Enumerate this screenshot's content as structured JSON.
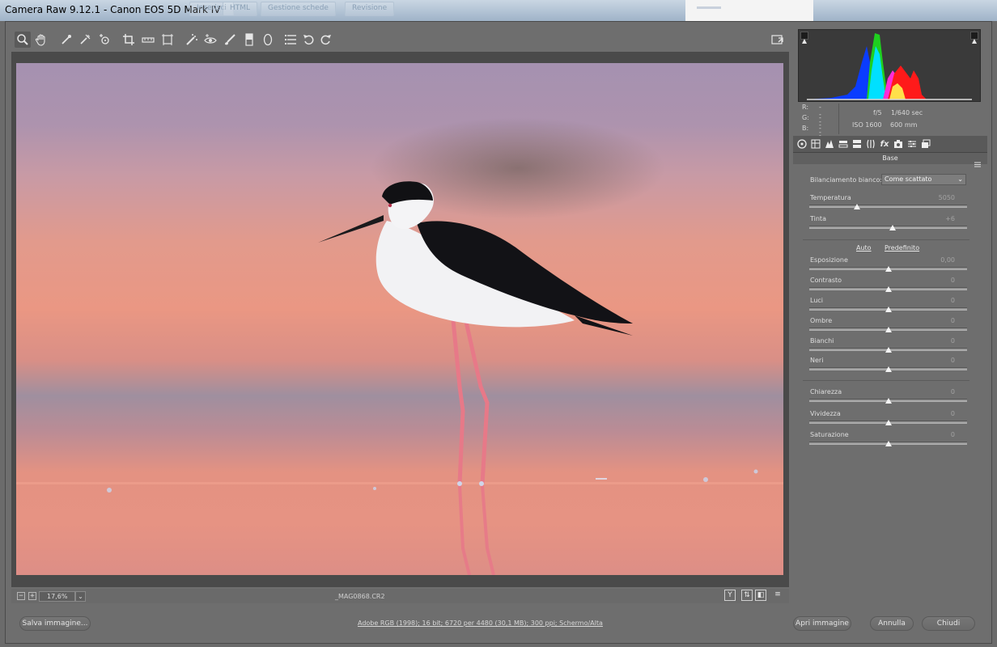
{
  "window": {
    "title": "Camera Raw 9.12.1  -  Canon EOS 5D Mark IV",
    "background_tabs": [
      "Inserisci",
      "HTML",
      "Gestione schede",
      "Revisione"
    ]
  },
  "toolbar": {
    "tools": [
      "zoom-tool",
      "hand-tool",
      "white-balance-tool",
      "color-sampler-tool",
      "targeted-adjustment-tool",
      "crop-tool",
      "straighten-tool",
      "transform-tool",
      "spot-removal-tool",
      "red-eye-tool",
      "adjustment-brush",
      "graduated-filter",
      "radial-filter",
      "preferences",
      "rotate-left",
      "rotate-right"
    ],
    "fullscreen_icon": "fullscreen-icon"
  },
  "status": {
    "zoom_minus": "−",
    "zoom_plus": "+",
    "zoom_value": "17,6%",
    "zoom_caret": "⌄",
    "filename": "_MAG0868.CR2",
    "view_toggles": [
      "Y",
      "⇅",
      "◧",
      "≡"
    ]
  },
  "histogram": {
    "readout": {
      "r": "R:",
      "g": "G:",
      "b": "B:",
      "r_val": "---",
      "g_val": "---",
      "b_val": "---"
    },
    "exposure": {
      "aperture": "f/5",
      "shutter": "1/640 sec",
      "iso": "ISO 1600",
      "focal": "600 mm"
    }
  },
  "panel": {
    "section_title": "Base",
    "white_balance_label": "Bilanciamento bianco:",
    "white_balance_value": "Come scattato",
    "auto_link": "Auto",
    "default_link": "Predefinito",
    "sliders": [
      {
        "label": "Temperatura",
        "value": "5050",
        "pos": 0.3
      },
      {
        "label": "Tinta",
        "value": "+6",
        "pos": 0.53
      },
      {
        "label": "Esposizione",
        "value": "0,00",
        "pos": 0.5
      },
      {
        "label": "Contrasto",
        "value": "0",
        "pos": 0.5
      },
      {
        "label": "Luci",
        "value": "0",
        "pos": 0.5
      },
      {
        "label": "Ombre",
        "value": "0",
        "pos": 0.5
      },
      {
        "label": "Bianchi",
        "value": "0",
        "pos": 0.5
      },
      {
        "label": "Neri",
        "value": "0",
        "pos": 0.5
      },
      {
        "label": "Chiarezza",
        "value": "0",
        "pos": 0.5
      },
      {
        "label": "Vividezza",
        "value": "0",
        "pos": 0.5
      },
      {
        "label": "Saturazione",
        "value": "0",
        "pos": 0.5
      }
    ]
  },
  "footer": {
    "save_button": "Salva immagine...",
    "info_link": "Adobe RGB (1998); 16 bit; 6720 per 4480 (30,1 MB); 300 ppi; Schermo/Alta",
    "open_button": "Apri immagine",
    "cancel_button": "Annulla",
    "close_button": "Chiudi"
  }
}
